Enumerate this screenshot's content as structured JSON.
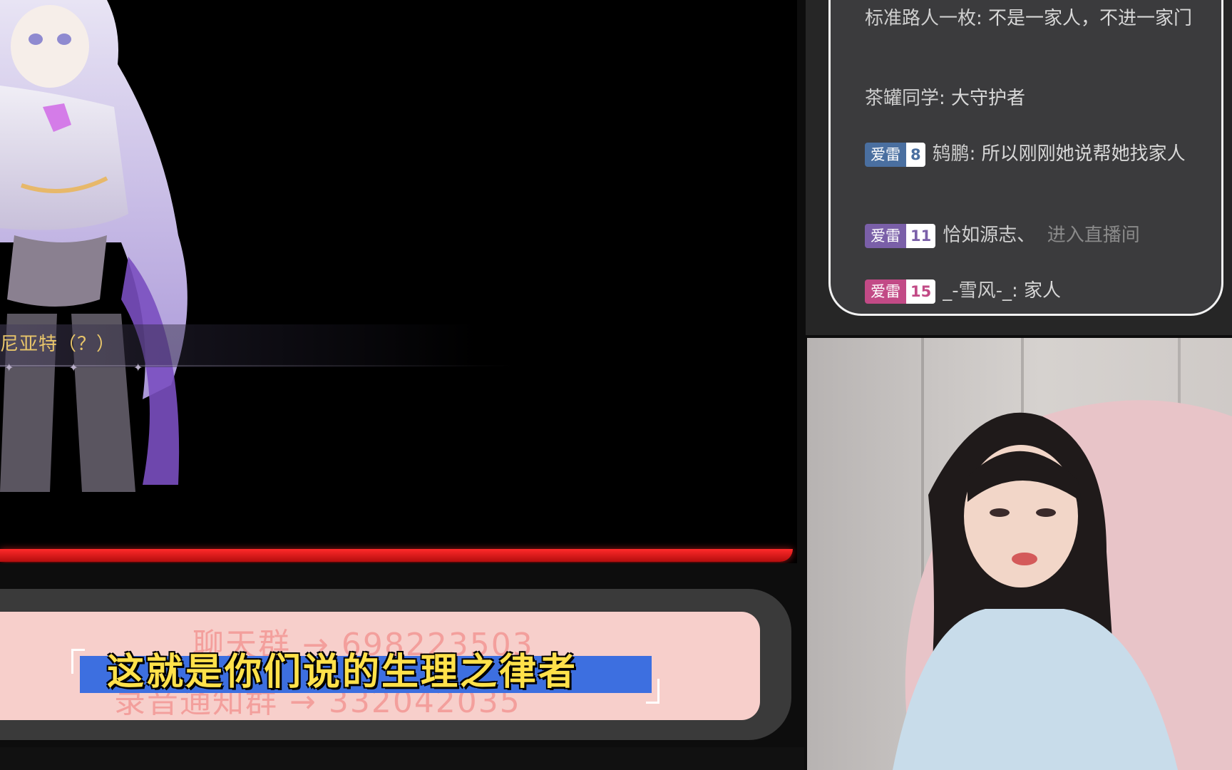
{
  "game": {
    "speaker_name": "尼亚特（？）",
    "stars": "✦ ✦ ✦"
  },
  "chat": {
    "messages": [
      {
        "user": "标准路人一枚",
        "text": "不是一家人，不进一家门"
      },
      {
        "user": "茶罐同学",
        "text": "大守护者"
      },
      {
        "badge_name": "爱雷",
        "badge_level": "8",
        "badge_color": "#4a6fa0",
        "user": "鸫鹏",
        "text": "所以刚刚她说帮她找家人"
      },
      {
        "badge_name": "爱雷",
        "badge_level": "11",
        "badge_color": "#7a5fa8",
        "user": "恰如源志、",
        "text": "进入直播间"
      },
      {
        "badge_name": "爱雷",
        "badge_level": "15",
        "badge_color": "#c24a86",
        "user": "_-雪风-_",
        "text": "家人"
      }
    ]
  },
  "banner": {
    "group_line_1": "聊天群 → 698223503",
    "group_line_2": "录音通知群 → 332042035",
    "subtitle": "这就是你们说的生理之律者"
  },
  "colors": {
    "accent_red": "#e01818",
    "subtitle_yellow": "#ffe14a",
    "subtitle_blue": "#3d6fe0",
    "banner_pink": "#f7cfcb"
  }
}
